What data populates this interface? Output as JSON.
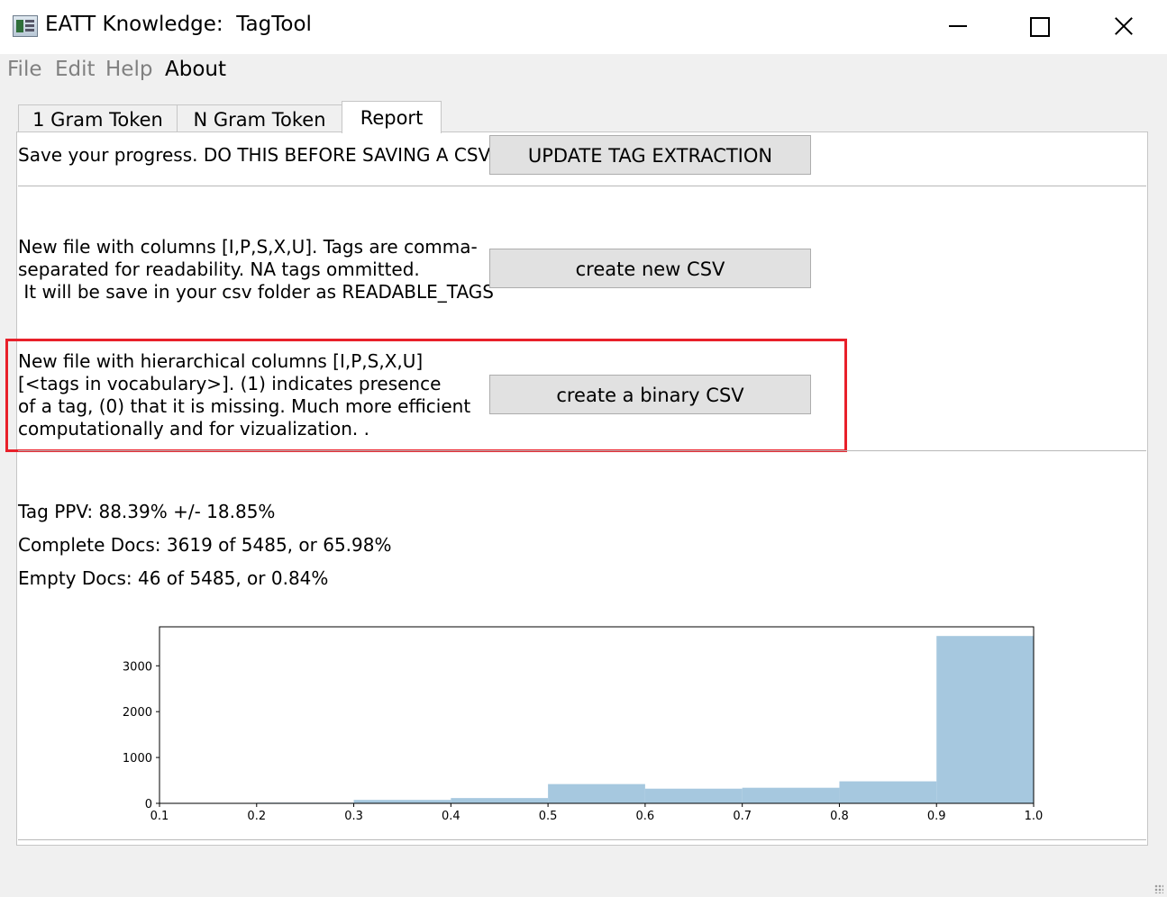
{
  "window": {
    "title": "EATT Knowledge:  TagTool",
    "minimize_icon": "minimize-icon",
    "maximize_icon": "maximize-icon",
    "close_icon": "close-icon"
  },
  "menu": {
    "file": "File",
    "edit": "Edit",
    "help": "Help",
    "about": "About"
  },
  "tabs": {
    "one_gram": "1 Gram Token",
    "n_gram": "N Gram Token",
    "report": "Report"
  },
  "report": {
    "save_progress_text": "Save your progress. DO THIS BEFORE SAVING A CSV!",
    "update_button": "UPDATE TAG EXTRACTION",
    "readable_text": "New file with columns [I,P,S,X,U]. Tags are comma-\nseparated for readability. NA tags ommitted.\n It will be save in your csv folder as READABLE_TAGS",
    "create_csv_button": "create new CSV",
    "binary_text": "New file with hierarchical columns [I,P,S,X,U]\n[<tags in vocabulary>]. (1) indicates presence\nof a tag, (0) that it is missing. Much more efficient\ncomputationally and for vizualization. .",
    "binary_button": "create a binary CSV",
    "highlight_color": "#e8202a"
  },
  "stats": {
    "tag_ppv": "Tag PPV: 88.39% +/- 18.85%",
    "complete_docs": "Complete Docs: 3619 of 5485, or 65.98%",
    "empty_docs": "Empty Docs: 46 of 5485, or 0.84%"
  },
  "chart_data": {
    "type": "bar",
    "title": "",
    "xlabel": "",
    "ylabel": "",
    "bin_edges": [
      0.1,
      0.2,
      0.3,
      0.4,
      0.5,
      0.6,
      0.7,
      0.8,
      0.9,
      1.0
    ],
    "values": [
      10,
      15,
      75,
      115,
      420,
      320,
      340,
      480,
      3650
    ],
    "xlim": [
      0.1,
      1.0
    ],
    "ylim": [
      0,
      3850
    ],
    "xticks": [
      "0.1",
      "0.2",
      "0.3",
      "0.4",
      "0.5",
      "0.6",
      "0.7",
      "0.8",
      "0.9",
      "1.0"
    ],
    "yticks": [
      "0",
      "1000",
      "2000",
      "3000"
    ],
    "bar_color": "#a6c8df",
    "grid": false
  }
}
